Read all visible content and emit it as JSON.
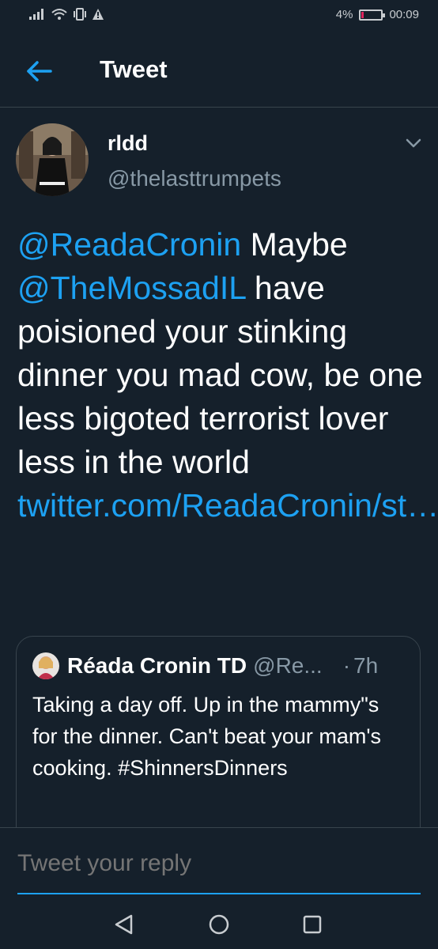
{
  "status_bar": {
    "battery_percent": "4%",
    "time": "00:09"
  },
  "header": {
    "title": "Tweet"
  },
  "tweet": {
    "author_name": "rldd",
    "author_handle": "@thelasttrumpets",
    "mention_1": "@ReadaCronin",
    "text_1": " Maybe ",
    "mention_2": "@TheMossadIL",
    "text_2": " have poisioned your stinking dinner you mad cow, be one less bigoted terrorist lover less in the world ",
    "link": "twitter.com/ReadaCronin/st…"
  },
  "quoted_tweet": {
    "author_name": "Réada Cronin TD",
    "author_handle": "@Re...",
    "dot": "·",
    "time": "7h",
    "text": "Taking a day off. Up in the mammy\"s for the dinner. Can't beat your mam's cooking. #ShinnersDinners"
  },
  "reply": {
    "placeholder": "Tweet your reply"
  },
  "colors": {
    "background": "#15202b",
    "accent": "#1da1f2",
    "secondary_text": "#8899a6",
    "border": "#38444d"
  }
}
